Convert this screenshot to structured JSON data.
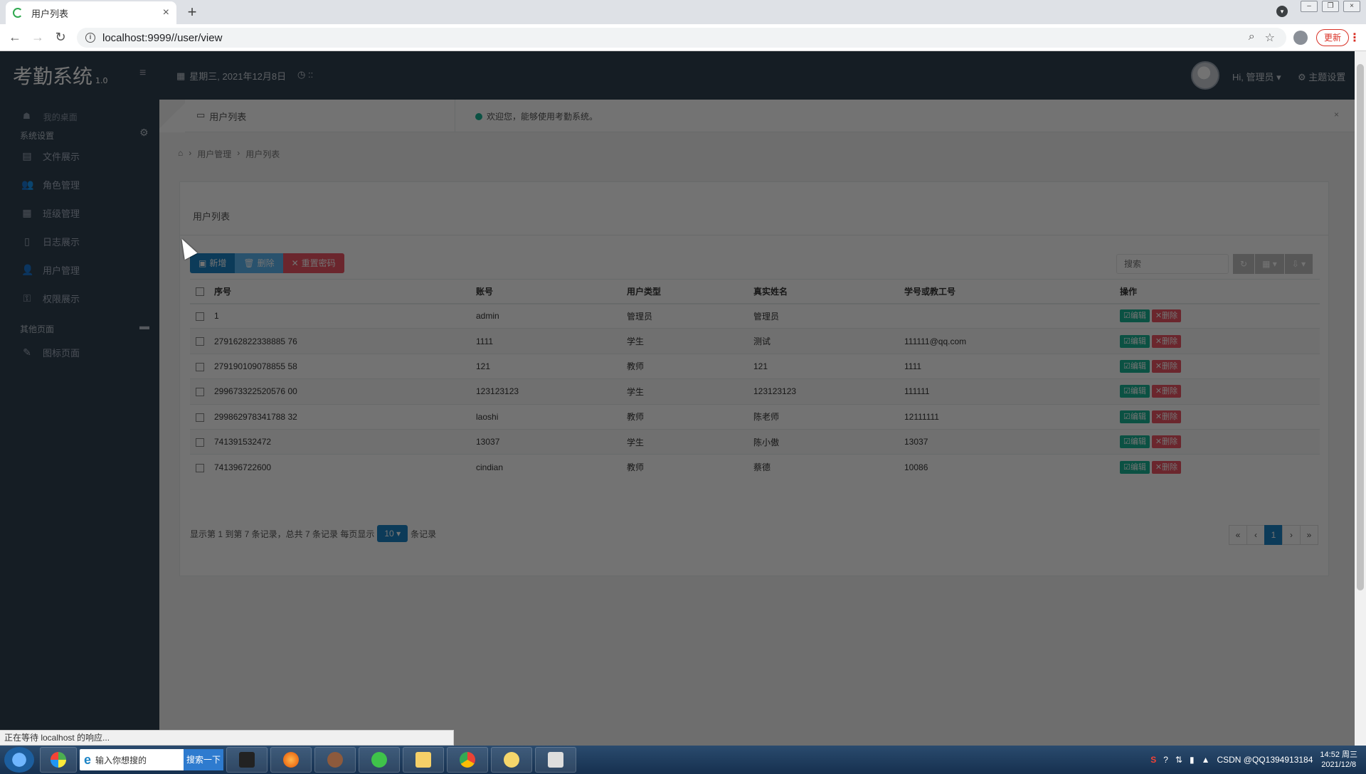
{
  "browser": {
    "tab_title": "用户列表",
    "new_tab": "+",
    "url": "localhost:9999//user/view",
    "update_label": "更新",
    "status_text": "正在等待 localhost 的响应..."
  },
  "header": {
    "brand": "考勤系统",
    "version": "1.0",
    "date": "星期三, 2021年12月8日",
    "clock": "::",
    "user": "Hi, 管理员",
    "theme": "主题设置"
  },
  "sidebar": {
    "home": "我的桌面",
    "section_system": "系统设置",
    "items": [
      {
        "label": "文件展示",
        "icon": "file-icon"
      },
      {
        "label": "角色管理",
        "icon": "users-icon"
      },
      {
        "label": "班级管理",
        "icon": "grid-icon"
      },
      {
        "label": "日志展示",
        "icon": "log-icon"
      },
      {
        "label": "用户管理",
        "icon": "user-icon"
      },
      {
        "label": "权限展示",
        "icon": "key-icon"
      }
    ],
    "section_other": "其他页面",
    "other_items": [
      {
        "label": "图标页面",
        "icon": "pencil-icon"
      }
    ]
  },
  "content_tabs": {
    "active_tab": "用户列表",
    "welcome": "欢迎您，能够使用考勤系统。"
  },
  "breadcrumb": [
    "用户管理",
    "用户列表"
  ],
  "panel": {
    "title": "用户列表",
    "toolbar": {
      "add": "新增",
      "delete": "删除",
      "reset": "重置密码"
    },
    "search_placeholder": "搜索",
    "columns": [
      "序号",
      "账号",
      "用户类型",
      "真实姓名",
      "学号或教工号",
      "操作"
    ],
    "rows": [
      [
        "1",
        "admin",
        "管理员",
        "管理员",
        ""
      ],
      [
        "279162822338885 76",
        "1111",
        "学生",
        "测试",
        "111111@qq.com"
      ],
      [
        "279190109078855 58",
        "121",
        "教师",
        "121",
        "1111"
      ],
      [
        "299673322520576 00",
        "123123123",
        "学生",
        "123123123",
        "111111"
      ],
      [
        "299862978341788 32",
        "laoshi",
        "教师",
        "陈老师",
        "12111111"
      ],
      [
        "741391532472",
        "13037",
        "学生",
        "陈小傲",
        "13037"
      ],
      [
        "741396722600",
        "cindian",
        "教师",
        "蔡德",
        "10086"
      ]
    ],
    "edit_label": "编辑",
    "remove_label": "删除",
    "pager": {
      "info_prefix": "显示第 1 到第 7 条记录，总共 7 条记录 每页显示",
      "page_size": "10",
      "info_suffix": "条记录",
      "first": "«",
      "prev": "‹",
      "current": "1",
      "next": "›",
      "last": "»"
    }
  },
  "taskbar": {
    "search_text": "输入你想搜的",
    "search_button": "搜索一下",
    "clock_time": "14:52 周三",
    "clock_date": "2021/12/8",
    "watermark": "CSDN @QQ1394913184"
  }
}
